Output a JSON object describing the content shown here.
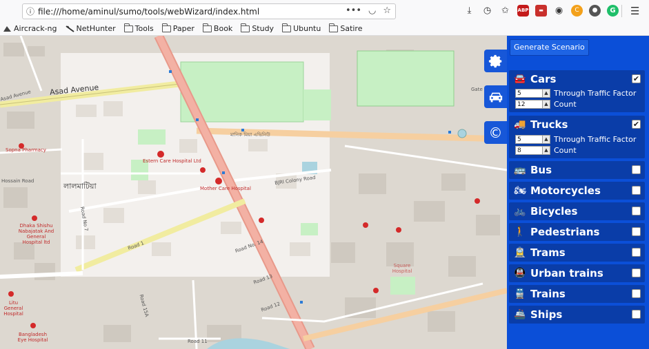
{
  "browser": {
    "url": "file:///home/aminul/sumo/tools/webWizard/index.html",
    "url_actions": [
      "•••",
      "pocket-icon",
      "star-icon"
    ],
    "toolbar_icons": [
      "download-icon",
      "history-icon",
      "reader-icon",
      "ABP",
      "RSS",
      "devtools-icon",
      "clipper-icon",
      "dark-addon-icon",
      "grammarly-icon"
    ],
    "abp_label": "ABP"
  },
  "bookmarks": [
    {
      "icon": "app-icon",
      "label": "Aircrack-ng"
    },
    {
      "icon": "app-icon",
      "label": "NetHunter"
    },
    {
      "icon": "folder-icon",
      "label": "Tools"
    },
    {
      "icon": "folder-icon",
      "label": "Paper"
    },
    {
      "icon": "folder-icon",
      "label": "Book"
    },
    {
      "icon": "folder-icon",
      "label": "Study"
    },
    {
      "icon": "folder-icon",
      "label": "Ubuntu"
    },
    {
      "icon": "folder-icon",
      "label": "Satire"
    }
  ],
  "map": {
    "labels": {
      "asad_avenue": "Asad Avenue",
      "asad_avenue_w": "Asad Avenue",
      "hospital_estern": "Estern Care Hospital Ltd",
      "hospital_mother": "Mother Care Hospital",
      "sopna": "Sopna Pharmacy",
      "dhaka_shishu": "Dhaka Shishu Nabajatak And General Hospital ltd",
      "litu": "Litu General Hospital",
      "bangladesh_eye": "Bangladesh Eye Hospital",
      "square": "Square Hospital",
      "bjri": "BJRI Colony Road",
      "lalmatia": "লালমাটিয়া",
      "hossain_road": "Hossain Road",
      "road_no7": "Road No 7",
      "road_no14": "Road No. 14",
      "road_13": "Road 13",
      "road_12": "Road 12",
      "road_1": "Road 1",
      "road_11": "Road 11",
      "road_15a": "Road 15A",
      "gate": "Gate",
      "manik_mia": "মানিক মিয়া এভিনিউ"
    }
  },
  "side_tabs": [
    "gear-icon",
    "car-icon",
    "copyright-icon"
  ],
  "panel": {
    "generate_label": "Generate Scenario",
    "modes": [
      {
        "name": "Cars",
        "icon": "car-icon",
        "checked": true,
        "through_traffic": "5",
        "count": "12",
        "through_label": "Through Traffic Factor",
        "count_label": "Count"
      },
      {
        "name": "Trucks",
        "icon": "truck-icon",
        "checked": true,
        "through_traffic": "5",
        "count": "8",
        "through_label": "Through Traffic Factor",
        "count_label": "Count"
      },
      {
        "name": "Bus",
        "icon": "bus-icon",
        "checked": false
      },
      {
        "name": "Motorcycles",
        "icon": "motorcycle-icon",
        "checked": false
      },
      {
        "name": "Bicycles",
        "icon": "bicycle-icon",
        "checked": false
      },
      {
        "name": "Pedestrians",
        "icon": "pedestrian-icon",
        "checked": false
      },
      {
        "name": "Trams",
        "icon": "tram-icon",
        "checked": false
      },
      {
        "name": "Urban trains",
        "icon": "subway-icon",
        "checked": false
      },
      {
        "name": "Trains",
        "icon": "train-icon",
        "checked": false
      },
      {
        "name": "Ships",
        "icon": "ship-icon",
        "checked": false
      }
    ]
  }
}
